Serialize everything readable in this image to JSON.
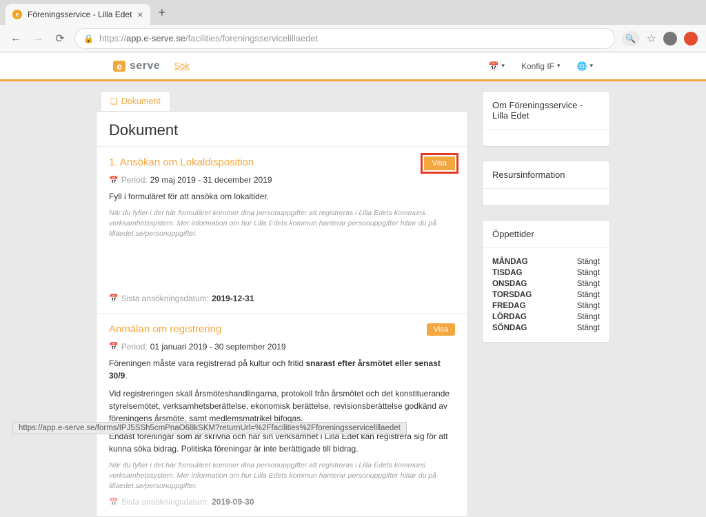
{
  "browser": {
    "tab_title": "Föreningsservice - Lilla Edet",
    "url_prefix": "https://",
    "url_host": "app.e-serve.se",
    "url_path": "/facilities/foreningsservicelillaedet",
    "status_url": "https://app.e-serve.se/forms/IPJ5SSh5cmPnaO68kSKM?returnUrl=%2Ffacilities%2Fforeningsservicelillaedet"
  },
  "header": {
    "logo_mark": "e",
    "logo_text": "serve",
    "search_link": "Sök",
    "account_label": "Konfig IF"
  },
  "tab_label": "Dokument",
  "page_title": "Dokument",
  "documents": [
    {
      "title": "1. Ansökan om Lokaldisposition",
      "visa_label": "Visa",
      "highlight": true,
      "period_label": "Period:",
      "period_value": "29 maj 2019 - 31 december 2019",
      "desc": "Fyll i formuläret för att ansöka om lokaltider.",
      "note": "När du fyller i det här formuläret kommer dina personuppgifter att registreras i Lilla Edets kommuns verksamhetssystem. Mer information om hur Lilla Edets kommun hanterar personuppgifter hittar du på lillaedet.se/personuppgifter.",
      "deadline_label": "Sista ansökningsdatum:",
      "deadline_value": "2019-12-31"
    },
    {
      "title": "Anmälan om registrering",
      "visa_label": "Visa",
      "highlight": false,
      "period_label": "Period:",
      "period_value": "01 januari 2019 - 30 september 2019",
      "desc_pre": "Föreningen måste vara registrerad på kultur och fritid ",
      "desc_bold": "snarast efter årsmötet eller senast 30/9",
      "desc_post": ".",
      "desc2": "Vid registreringen skall årsmöteshandlingarna, protokoll från årsmötet och det konstituerande styrelsemötet, verksamhetsberättelse, ekonomisk berättelse, revisionsberättelse godkänd av föreningens årsmöte, samt medlemsmatrikel bifogas.",
      "desc3": "Endast föreningar som är skrivna och har sin verksamhet i Lilla Edet kan registrera sig för att kunna söka bidrag. Politiska föreningar är inte berättigade till bidrag.",
      "note": "När du fyller i det här formuläret kommer dina personuppgifter att registreras i Lilla Edets kommuns verksamhetssystem. Mer information om hur Lilla Edets kommun hanterar personuppgifter hittar du på lillaedet.se/personuppgifter.",
      "deadline_label": "Sista ansökningsdatum:",
      "deadline_value": "2019-09-30"
    }
  ],
  "sidebar": {
    "about_title": "Om Föreningsservice - Lilla Edet",
    "resource_title": "Resursinformation",
    "hours_title": "Öppettider",
    "hours": [
      {
        "day": "MÅNDAG",
        "status": "Stängt"
      },
      {
        "day": "TISDAG",
        "status": "Stängt"
      },
      {
        "day": "ONSDAG",
        "status": "Stängt"
      },
      {
        "day": "TORSDAG",
        "status": "Stängt"
      },
      {
        "day": "FREDAG",
        "status": "Stängt"
      },
      {
        "day": "LÖRDAG",
        "status": "Stängt"
      },
      {
        "day": "SÖNDAG",
        "status": "Stängt"
      }
    ]
  }
}
